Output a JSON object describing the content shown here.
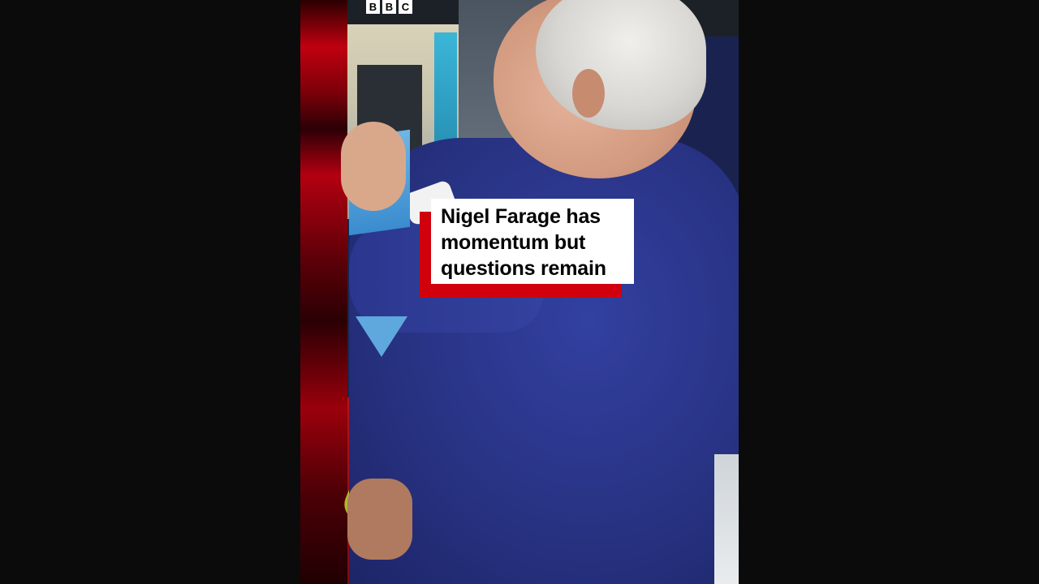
{
  "logo": {
    "letters": [
      "B",
      "B",
      "C"
    ]
  },
  "caption": {
    "lines": [
      "Nigel Farage has",
      "momentum but",
      "questions remain"
    ]
  },
  "colors": {
    "caption_accent": "#d0000d",
    "caption_background": "#ffffff",
    "letterbox": "#0b0b0b"
  }
}
